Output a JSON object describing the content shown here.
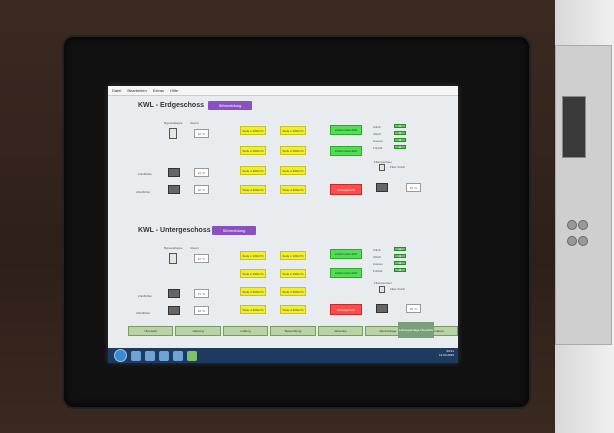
{
  "window": {
    "menu": [
      "Datei",
      "Bearbeiten",
      "Extras",
      "Hilfe"
    ]
  },
  "sections": [
    {
      "title": "KWL - Erdgeschoss",
      "tag": "Störmeldung",
      "labels": {
        "device": "Bypassklappe",
        "device_value": "Istwert",
        "fan1": "Zuluftlüfter",
        "fan2": "Abluftlüfter"
      },
      "value_boxes": [
        "12 °C",
        "21 °C",
        "22 °C"
      ],
      "yellow_buttons": [
        "Stufe 1 100m³/h",
        "Stufe 1 100m³/h",
        "Stufe 2 200m³/h",
        "Stufe 2 200m³/h",
        "Stufe 3 300m³/h",
        "Stufe 3 300m³/h",
        "Stufe 4 400m³/h",
        "Stufe 4 400m³/h"
      ],
      "green_buttons": [
        "Lüftermodus EIN",
        "Lüftermodus EIN"
      ],
      "red_button": "Störung AUS",
      "status_labels": [
        "Zuluft",
        "Abluft",
        "Aussen",
        "Fortluft"
      ],
      "status_pills": [
        "ok",
        "ok",
        "ok",
        "ok"
      ],
      "right_labels": [
        "Filterwechsel",
        "Filter Zuluft"
      ]
    },
    {
      "title": "KWL - Untergeschoss",
      "tag": "Störmeldung",
      "labels": {
        "device": "Bypassklappe",
        "device_value": "Istwert",
        "fan1": "Zuluftlüfter",
        "fan2": "Abluftlüfter"
      },
      "value_boxes": [
        "12 °C",
        "21 °C",
        "22 °C"
      ],
      "yellow_buttons": [
        "Stufe 1 100m³/h",
        "Stufe 1 100m³/h",
        "Stufe 2 200m³/h",
        "Stufe 2 200m³/h",
        "Stufe 3 300m³/h",
        "Stufe 3 300m³/h",
        "Stufe 4 400m³/h",
        "Stufe 4 400m³/h"
      ],
      "green_buttons": [
        "Lüftermodus EIN",
        "Lüftermodus EIN"
      ],
      "red_button": "Störung AUS",
      "status_labels": [
        "Zuluft",
        "Abluft",
        "Aussen",
        "Fortluft"
      ],
      "status_pills": [
        "ok",
        "ok",
        "ok",
        "ok"
      ],
      "right_labels": [
        "Filterwechsel",
        "Filter Zuluft"
      ]
    }
  ],
  "bottom_nav": [
    "Übersicht",
    "Heizung",
    "Lüftung",
    "Beleuchtung",
    "Jalousien",
    "Alarmanlage",
    "Wetterstation",
    "Einstellungen"
  ],
  "bottom_badge": "Lüftungsanlage Übersicht",
  "taskbar": {
    "clock_time": "09:41",
    "clock_date": "12.03.2015"
  },
  "colors": {
    "accent_tag": "#8a4fc3",
    "yellow": "#f2ef2a",
    "green": "#4fe04f",
    "red": "#ff4b4b"
  }
}
